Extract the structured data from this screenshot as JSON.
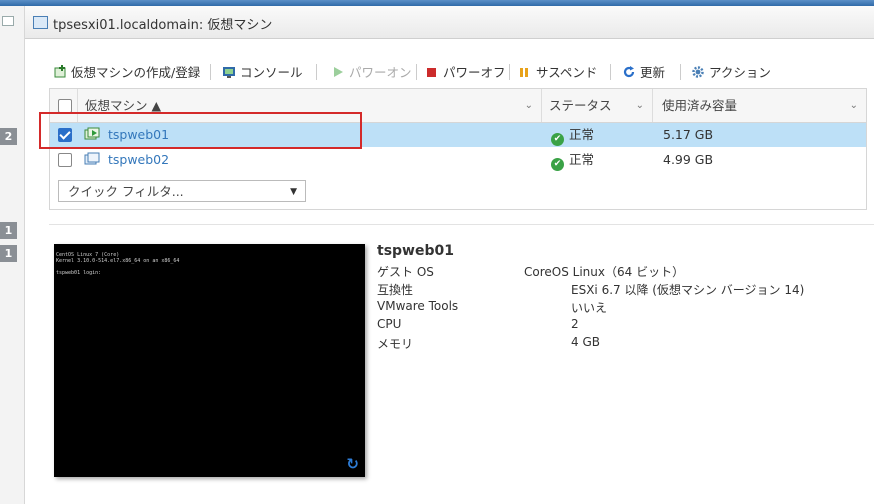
{
  "window": {
    "title": "tpsesxi01.localdomain: 仮想マシン"
  },
  "left_badges": [
    "2",
    "1",
    "1"
  ],
  "toolbar": {
    "create": "仮想マシンの作成/登録",
    "console": "コンソール",
    "power_on": "パワーオン",
    "power_off": "パワーオフ",
    "suspend": "サスペンド",
    "refresh": "更新",
    "actions": "アクション"
  },
  "grid": {
    "columns": [
      "仮想マシン ▲",
      "ステータス",
      "使用済み容量"
    ],
    "rows": [
      {
        "name": "tspweb01",
        "status": "正常",
        "used": "5.17 GB",
        "selected": true
      },
      {
        "name": "tspweb02",
        "status": "正常",
        "used": "4.99 GB",
        "selected": false
      }
    ],
    "filter_placeholder": "クイック フィルタ..."
  },
  "console": {
    "lines": [
      "CentOS Linux 7 (Core)",
      "Kernel 3.10.0-514.el7.x86_64 on an x86_64",
      "",
      "tspweb01 login:"
    ]
  },
  "details": {
    "name": "tspweb01",
    "guest_os_label": "ゲスト OS",
    "guest_os_value": "CoreOS Linux（64 ビット）",
    "compat_label": "互換性",
    "compat_value": "ESXi 6.7 以降 (仮想マシン バージョン 14)",
    "tools_label": "VMware Tools",
    "tools_value": "いいえ",
    "cpu_label": "CPU",
    "cpu_value": "2",
    "memory_label": "メモリ",
    "memory_value": "4 GB"
  },
  "colors": {
    "accent": "#2a6fc9",
    "selected_row": "#bde0f7",
    "highlight_box": "#d42a2a",
    "ok": "#3aa246"
  }
}
